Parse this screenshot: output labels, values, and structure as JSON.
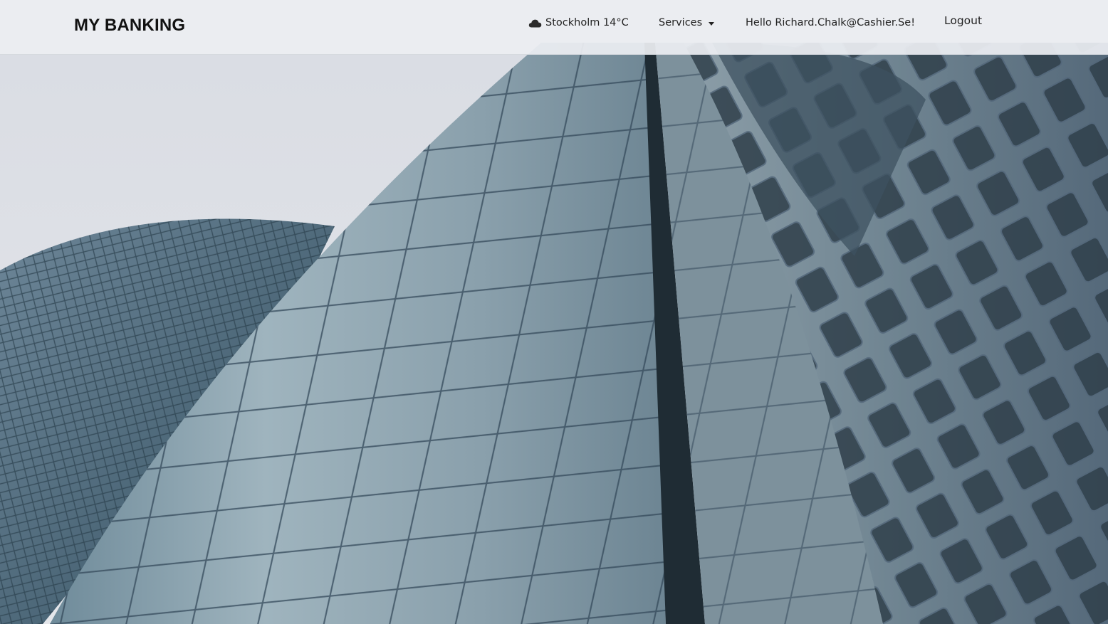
{
  "navbar": {
    "brand": "MY BANKING",
    "weather": {
      "icon": "cloud-icon",
      "label": "Stockholm 14°C"
    },
    "services": {
      "label": "Services",
      "icon": "caret-down-icon"
    },
    "greeting": "Hello Richard.Chalk@Cashier.Se!",
    "logout_label": "Logout"
  },
  "hero": {
    "image": "skyscrapers-background"
  },
  "colors": {
    "navbar_bg": "#eceef2",
    "text": "#222222",
    "sky": "#dfe2e8",
    "facade": "#6e8795"
  }
}
